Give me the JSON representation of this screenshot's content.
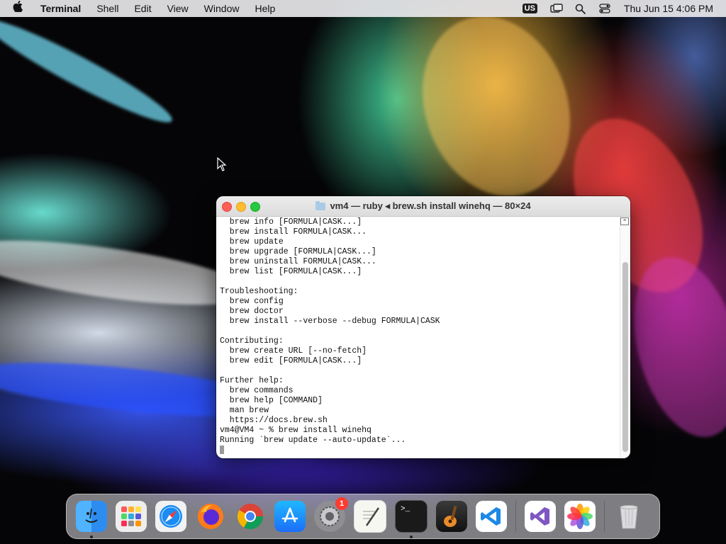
{
  "menubar": {
    "app_name": "Terminal",
    "items": [
      "Shell",
      "Edit",
      "View",
      "Window",
      "Help"
    ],
    "input_source": "US",
    "clock": "Thu Jun 15  4:06 PM"
  },
  "terminal": {
    "title": "vm4 — ruby ◂ brew.sh install winehq — 80×24",
    "lines": [
      "  brew info [FORMULA|CASK...]",
      "  brew install FORMULA|CASK...",
      "  brew update",
      "  brew upgrade [FORMULA|CASK...]",
      "  brew uninstall FORMULA|CASK...",
      "  brew list [FORMULA|CASK...]",
      "",
      "Troubleshooting:",
      "  brew config",
      "  brew doctor",
      "  brew install --verbose --debug FORMULA|CASK",
      "",
      "Contributing:",
      "  brew create URL [--no-fetch]",
      "  brew edit [FORMULA|CASK...]",
      "",
      "Further help:",
      "  brew commands",
      "  brew help [COMMAND]",
      "  man brew",
      "  https://docs.brew.sh",
      "vm4@VM4 ~ % brew install winehq",
      "Running `brew update --auto-update`..."
    ]
  },
  "dock": {
    "settings_badge": "1",
    "colors": {
      "finder": "#2d8cf0",
      "safari": "#1a8cf5",
      "firefox": "#ff7a18",
      "appstore": "#1c8ef9",
      "terminal": "#1a1a1a",
      "vscode": "#1e88e5",
      "visualstudio": "#7e57c2"
    }
  },
  "colors": {
    "close": "#ff5f57",
    "minimize": "#febc2e",
    "zoom": "#28c840"
  }
}
